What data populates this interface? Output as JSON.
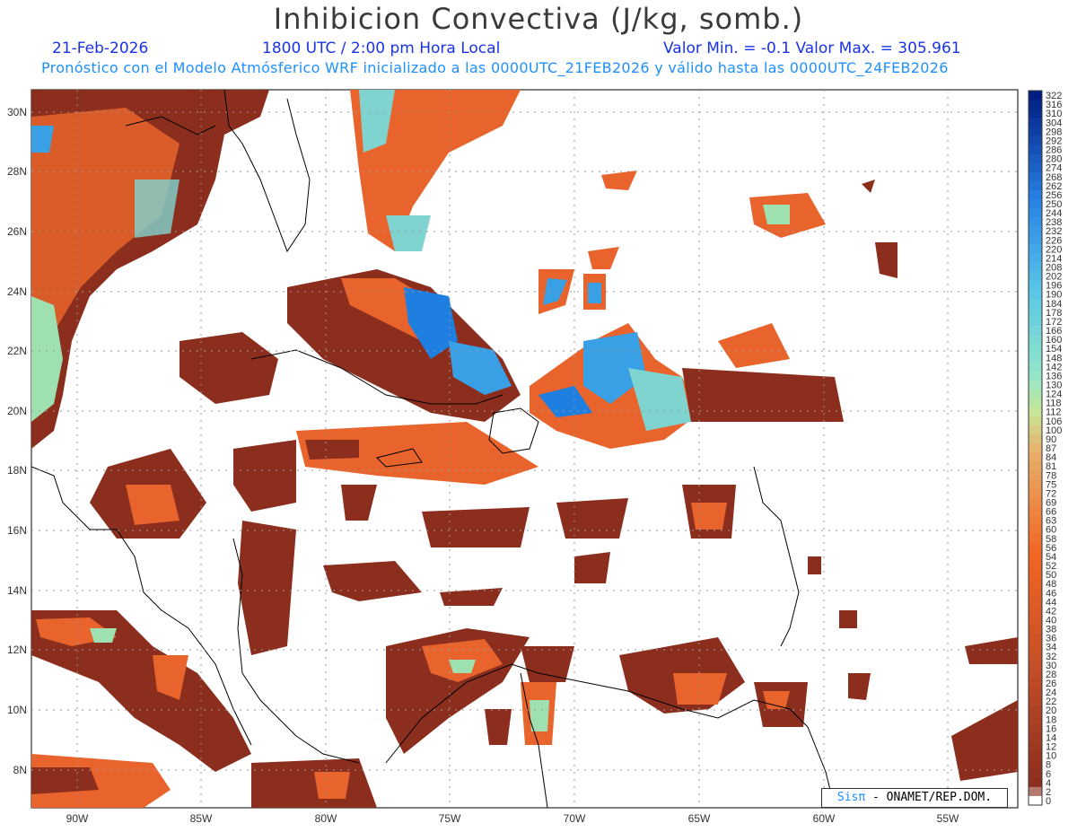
{
  "header": {
    "title": "Inhibicion Convectiva (J/kg, somb.)",
    "date": "21-Feb-2026",
    "time": "1800 UTC / 2:00 pm Hora Local",
    "minmax": "Valor Min. = -0.1  Valor Max. = 305.961",
    "subtitle": "Pronóstico con el Modelo Atmósferico WRF inicializado a las 0000UTC_21FEB2026 y válido hasta las  0000UTC_24FEB2026"
  },
  "map": {
    "lat_labels": [
      "30N",
      "28N",
      "26N",
      "24N",
      "22N",
      "20N",
      "18N",
      "16N",
      "14N",
      "12N",
      "10N",
      "8N"
    ],
    "lon_labels": [
      "90W",
      "85W",
      "80W",
      "75W",
      "70W",
      "65W",
      "60W",
      "55W"
    ],
    "colors": {
      "low": "#8b2e1e",
      "mid": "#f26522",
      "high": "#1e7fe0",
      "land_border": "#000000",
      "grid": "#9a9a9a"
    }
  },
  "colorbar": {
    "ticks": [
      "322",
      "316",
      "310",
      "304",
      "298",
      "292",
      "286",
      "280",
      "274",
      "268",
      "262",
      "256",
      "250",
      "244",
      "238",
      "232",
      "226",
      "220",
      "214",
      "208",
      "202",
      "196",
      "190",
      "184",
      "178",
      "172",
      "166",
      "160",
      "154",
      "148",
      "142",
      "136",
      "130",
      "124",
      "118",
      "112",
      "106",
      "100",
      "90",
      "87",
      "84",
      "81",
      "78",
      "75",
      "72",
      "69",
      "66",
      "63",
      "60",
      "58",
      "56",
      "54",
      "52",
      "50",
      "48",
      "46",
      "44",
      "42",
      "40",
      "38",
      "36",
      "34",
      "32",
      "30",
      "28",
      "26",
      "24",
      "22",
      "20",
      "18",
      "16",
      "14",
      "12",
      "10",
      "8",
      "6",
      "4",
      "2",
      "0"
    ]
  },
  "credit": {
    "brand": "Sisπ",
    "text": " - ONAMET/REP.DOM."
  }
}
